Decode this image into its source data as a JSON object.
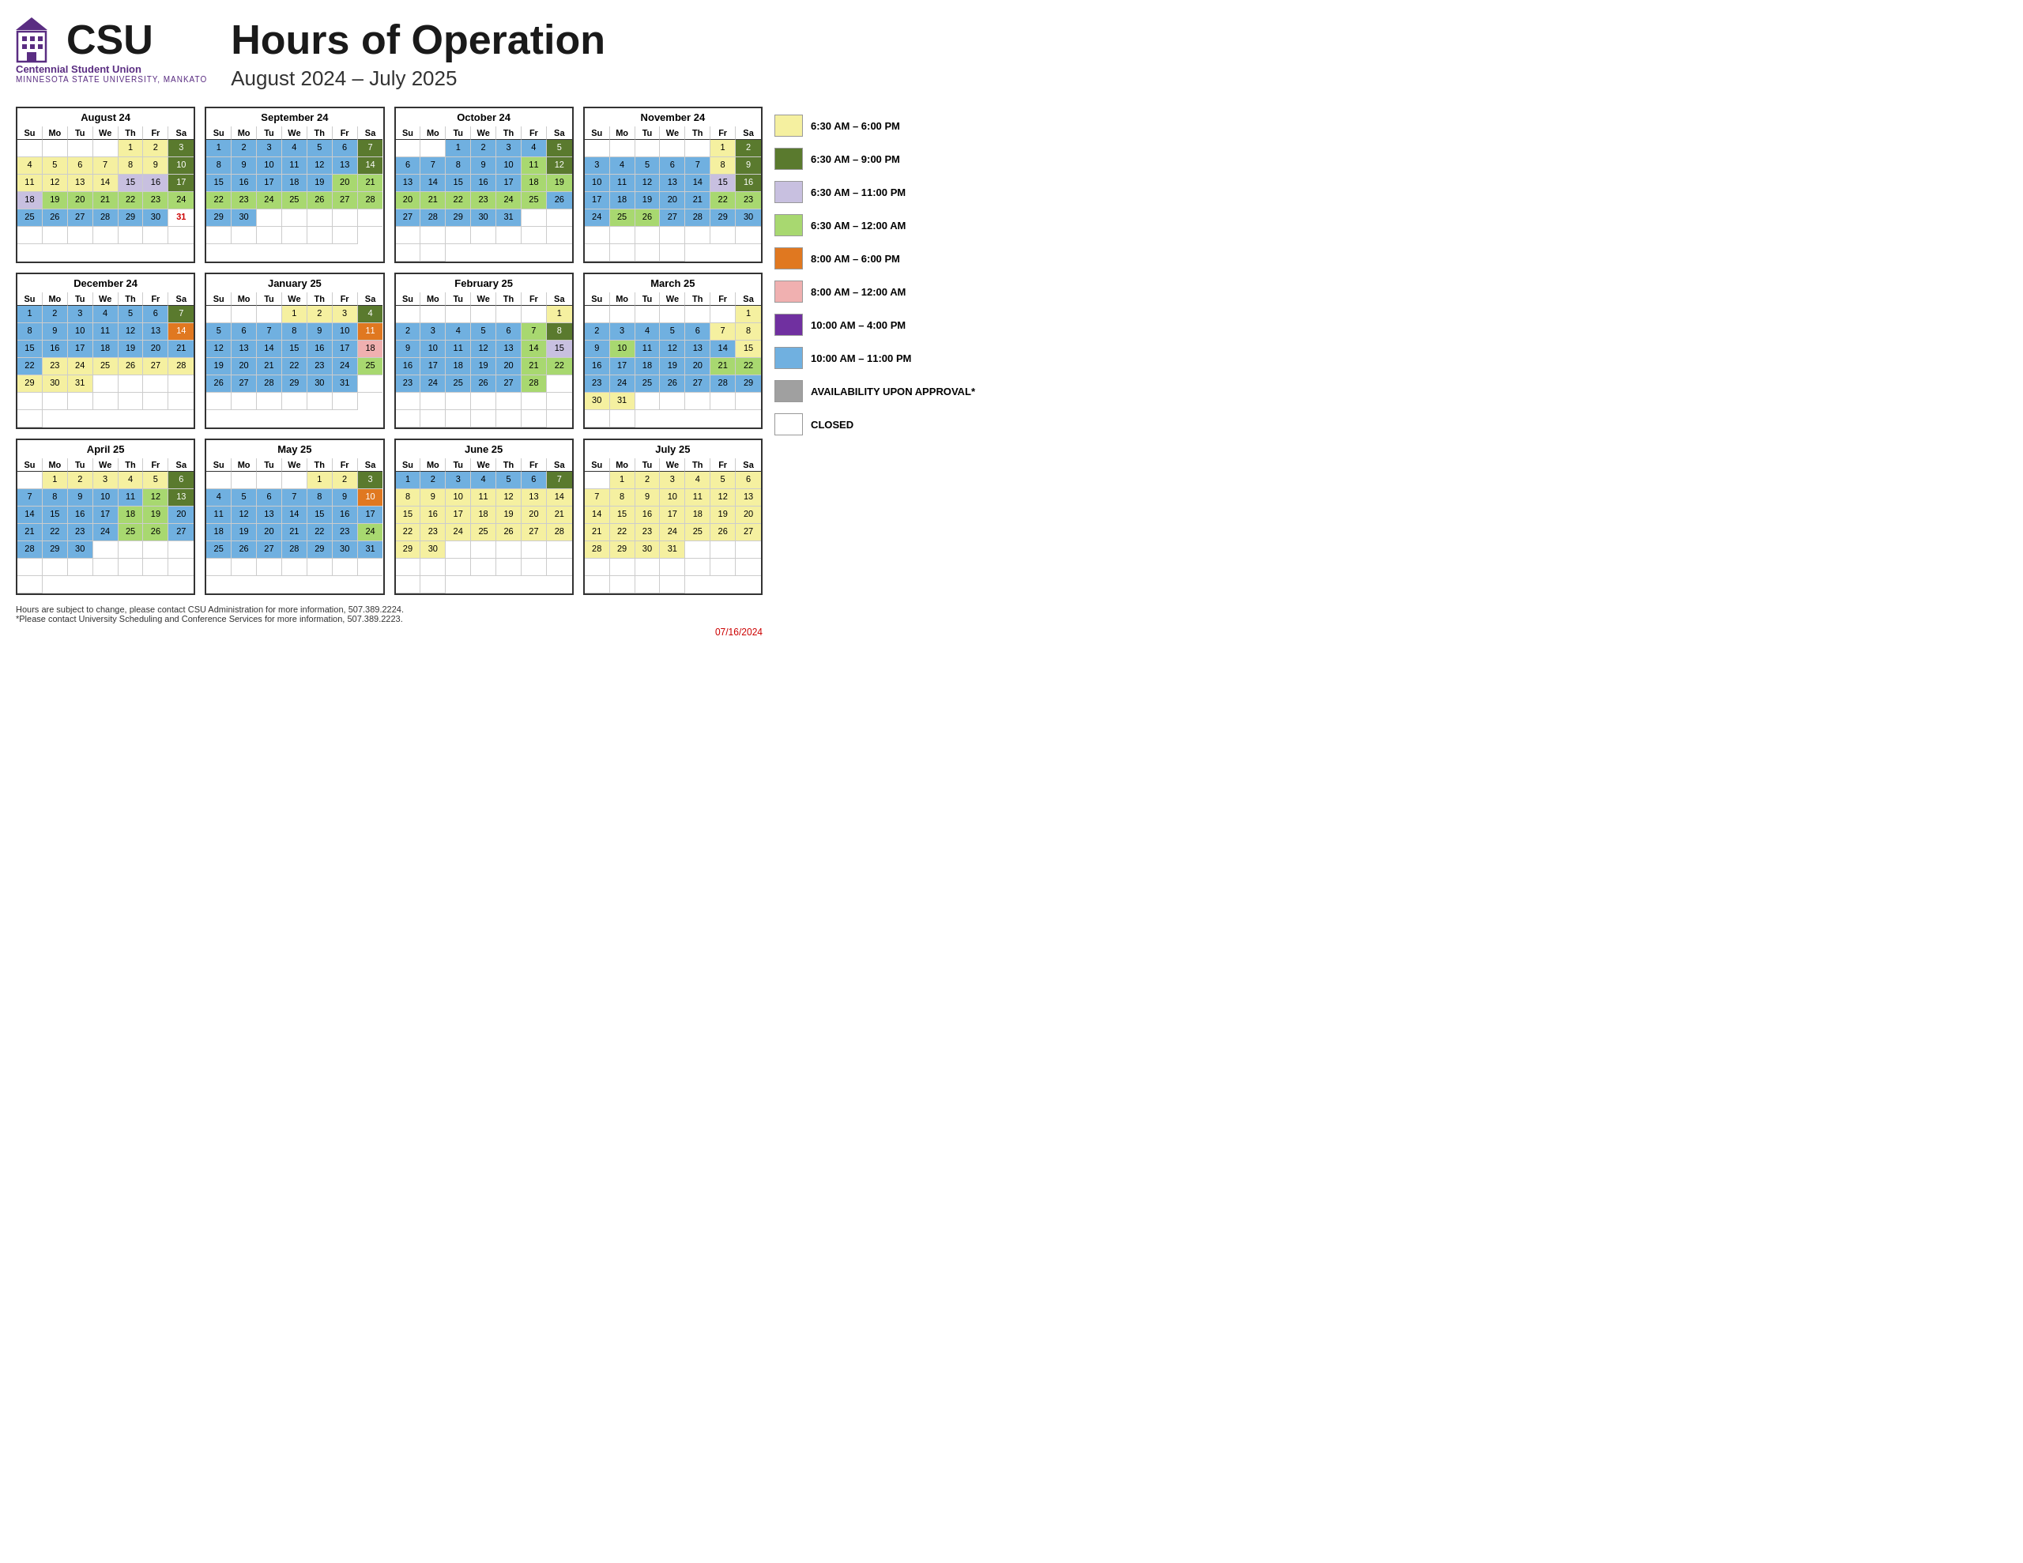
{
  "header": {
    "main_title": "Hours of Operation",
    "subtitle": "August 2024 – July 2025",
    "logo_csu": "CSU",
    "centennial": "Centennial Student Union",
    "mankato": "MINNESOTA STATE UNIVERSITY, MANKATO"
  },
  "legend": {
    "items": [
      {
        "color": "yellow",
        "label": "6:30 AM – 6:00 PM",
        "css": "background:#f5f0a0;"
      },
      {
        "color": "dark-green",
        "label": "6:30 AM – 9:00 PM",
        "css": "background:#5a7a2e;"
      },
      {
        "color": "lavender",
        "label": "6:30 AM – 11:00 PM",
        "css": "background:#c8c0e0;"
      },
      {
        "color": "light-green",
        "label": "6:30 AM – 12:00 AM",
        "css": "background:#a8d870;"
      },
      {
        "color": "orange",
        "label": "8:00 AM – 6:00 PM",
        "css": "background:#e07820;"
      },
      {
        "color": "pink",
        "label": "8:00 AM – 12:00 AM",
        "css": "background:#f0b0b0;"
      },
      {
        "color": "purple",
        "label": "10:00 AM – 4:00 PM",
        "css": "background:#7030a0;"
      },
      {
        "color": "blue",
        "label": "10:00 AM – 11:00 PM",
        "css": "background:#70b0e0;"
      },
      {
        "color": "gray",
        "label": "AVAILABILITY UPON APPROVAL*",
        "css": "background:#a0a0a0;"
      },
      {
        "color": "white",
        "label": "CLOSED",
        "css": "background:white;"
      }
    ]
  },
  "footer": {
    "line1": "Hours are subject to change, please contact CSU Administration for more information, 507.389.2224.",
    "line2": "*Please contact University Scheduling and Conference Services for more information, 507.389.2223.",
    "date": "07/16/2024"
  },
  "days": [
    "Su",
    "Mo",
    "Tu",
    "We",
    "Th",
    "Fr",
    "Sa"
  ]
}
